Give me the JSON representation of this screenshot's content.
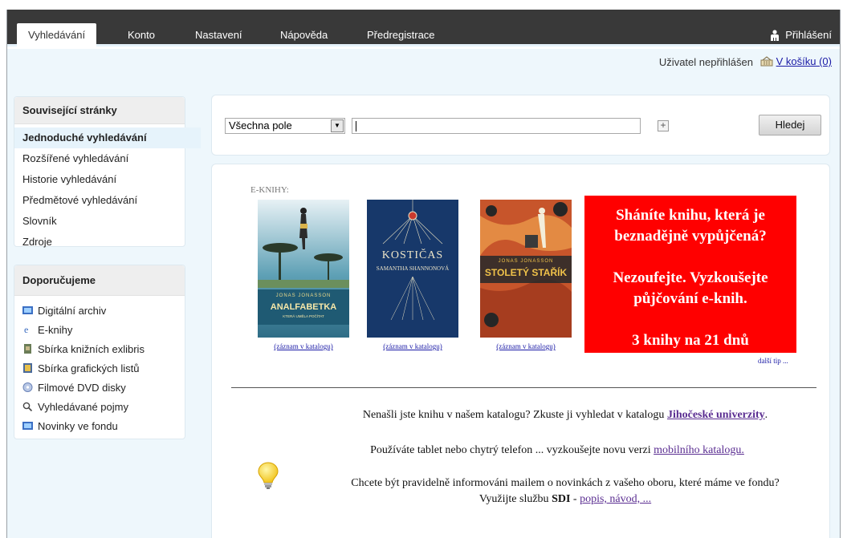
{
  "nav": {
    "tabs": [
      "Vyhledávání",
      "Konto",
      "Nastavení",
      "Nápověda",
      "Předregistrace"
    ],
    "active_tab": "Vyhledávání",
    "login_label": "Přihlášení"
  },
  "userbar": {
    "status": "Uživatel nepřihlášen",
    "cart_label": "V košíku (0)"
  },
  "sidebar": {
    "related_title": "Související stránky",
    "related_items": [
      "Jednoduché vyhledávání",
      "Rozšířené vyhledávání",
      "Historie vyhledávání",
      "Předmětové vyhledávání",
      "Slovník",
      "Zdroje"
    ],
    "recommend_title": "Doporučujeme",
    "recommend_items": [
      {
        "label": "Digitální archiv",
        "icon": "archive-icon"
      },
      {
        "label": "E-knihy",
        "icon": "ebook-icon"
      },
      {
        "label": "Sbírka knižních exlibris",
        "icon": "exlibris-icon"
      },
      {
        "label": "Sbírka grafických listů",
        "icon": "graphics-icon"
      },
      {
        "label": "Filmové DVD disky",
        "icon": "dvd-icon"
      },
      {
        "label": "Vyhledávané pojmy",
        "icon": "search-icon"
      },
      {
        "label": "Novinky ve fondu",
        "icon": "news-icon"
      }
    ]
  },
  "search": {
    "field_value": "Všechna pole",
    "query_value": "",
    "plus_label": "+",
    "button_label": "Hledej"
  },
  "content": {
    "ebooks_label": "E-KNIHY:",
    "books": [
      {
        "title": "ANALFABETKA",
        "author": "JONAS JONASSON",
        "subtitle": "KTERÁ UMĚLA POČÍTAT",
        "link": "(záznam v katalogu)"
      },
      {
        "title": "KOSTIČAS",
        "author": "SAMANTHA SHANNONOVÁ",
        "link": "(záznam v katalogu)"
      },
      {
        "title": "STOLETÝ STAŘÍK",
        "author": "JONAS JONASSON",
        "link": "(záznam v katalogu)"
      }
    ],
    "promo": {
      "line1": "Sháníte knihu, která je",
      "line2": "beznadějně vypůjčená?",
      "line3": "Nezoufejte. Vyzkoušejte",
      "line4": "půjčování e-knih.",
      "line5": "3 knihy na 21 dnů"
    },
    "next_tip": "další tip ...",
    "info1_text": "Nenašli jste knihu v našem katalogu? Zkuste ji vyhledat v katalogu ",
    "info1_link": "Jihočeské univerzity",
    "info1_end": ".",
    "info2_text": "Používáte tablet nebo chytrý telefon ... vyzkoušejte novu verzi ",
    "info2_link": "mobilního katalogu.",
    "info3_line1": "Chcete být pravidelně informováni mailem o novinkách z vašeho oboru, které máme ve fondu?",
    "info3_pre": "Využijte službu ",
    "info3_bold": "SDI",
    "info3_dash": " - ",
    "info3_link": "popis, návod, ..."
  }
}
